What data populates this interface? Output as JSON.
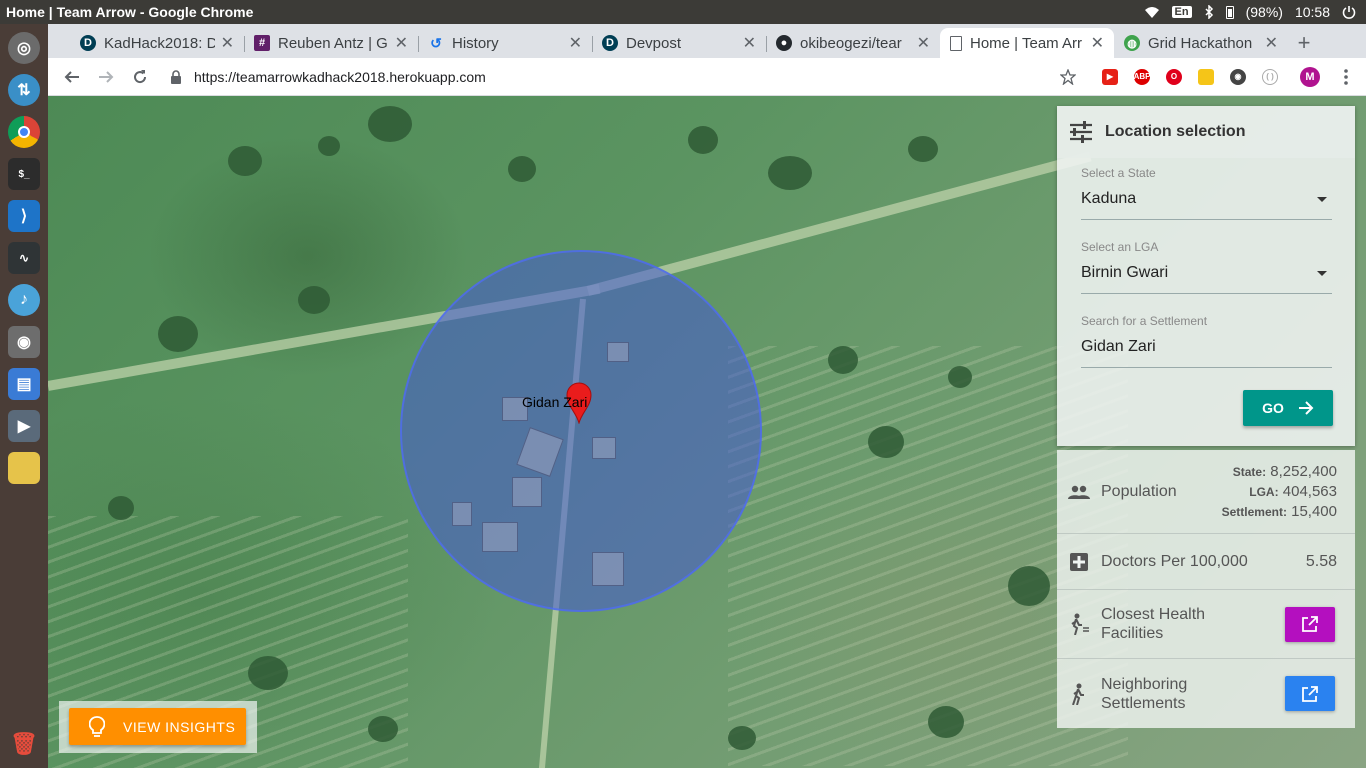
{
  "os": {
    "window_title": "Home | Team Arrow - Google Chrome",
    "keyboard_layout": "En",
    "battery": "(98%)",
    "clock": "10:58"
  },
  "tabs": [
    {
      "title": "KadHack2018: D",
      "icon": "devpost-icon"
    },
    {
      "title": "Reuben Antz | G",
      "icon": "slack-icon"
    },
    {
      "title": "History",
      "icon": "history-icon"
    },
    {
      "title": "Devpost",
      "icon": "devpost-icon"
    },
    {
      "title": "okibeogezi/tear",
      "icon": "github-icon"
    },
    {
      "title": "Home | Team Arr",
      "icon": "page-icon"
    },
    {
      "title": "Grid Hackathon",
      "icon": "globe-icon"
    }
  ],
  "toolbar": {
    "url": "https://teamarrowkadhack2018.herokuapp.com",
    "profile_initial": "M",
    "ext_abp": "ABP"
  },
  "map": {
    "marker_label": "Gidan Zari"
  },
  "location_panel": {
    "title": "Location selection",
    "state_label": "Select a State",
    "state_value": "Kaduna",
    "lga_label": "Select an LGA",
    "lga_value": "Birnin Gwari",
    "settlement_label": "Search for a Settlement",
    "settlement_value": "Gidan Zari",
    "go_label": "GO"
  },
  "stats": {
    "population_label": "Population",
    "state_key": "State:",
    "state_pop": "8,252,400",
    "lga_key": "LGA:",
    "lga_pop": "404,563",
    "settlement_key": "Settlement:",
    "settlement_pop": "15,400",
    "doctors_label": "Doctors Per 100,000",
    "doctors_value": "5.58",
    "health_label_1": "Closest Health",
    "health_label_2": "Facilities",
    "neighbor_label_1": "Neighboring",
    "neighbor_label_2": "Settlements",
    "health_btn_color": "#b40fbf",
    "neighbor_btn_color": "#2a82f0"
  },
  "insights": {
    "label": "VIEW INSIGHTS"
  }
}
